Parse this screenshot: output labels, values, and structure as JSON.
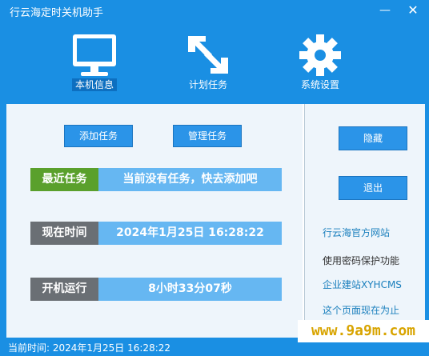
{
  "window": {
    "title": "行云海定时关机助手",
    "minimize_glyph": "—",
    "close_glyph": "✕"
  },
  "nav": [
    {
      "label": "本机信息",
      "icon": "monitor-icon",
      "active": true
    },
    {
      "label": "计划任务",
      "icon": "arrows-icon",
      "active": false
    },
    {
      "label": "系统设置",
      "icon": "gear-icon",
      "active": false
    }
  ],
  "buttons": {
    "add_task": "添加任务",
    "manage_task": "管理任务",
    "hide": "隐藏",
    "exit": "退出"
  },
  "rows": [
    {
      "label": "最近任务",
      "value": "当前没有任务，快去添加吧"
    },
    {
      "label": "现在时间",
      "value": "2024年1月25日  16:28:22"
    },
    {
      "label": "开机运行",
      "value": "8小时33分07秒"
    }
  ],
  "links": [
    "行云海官方网站",
    "使用密码保护功能",
    "企业建站XYHCMS",
    "这个页面现在为止"
  ],
  "status": "当前时间: 2024年1月25日 16:28:22",
  "watermark": "www.9a9m.com"
}
